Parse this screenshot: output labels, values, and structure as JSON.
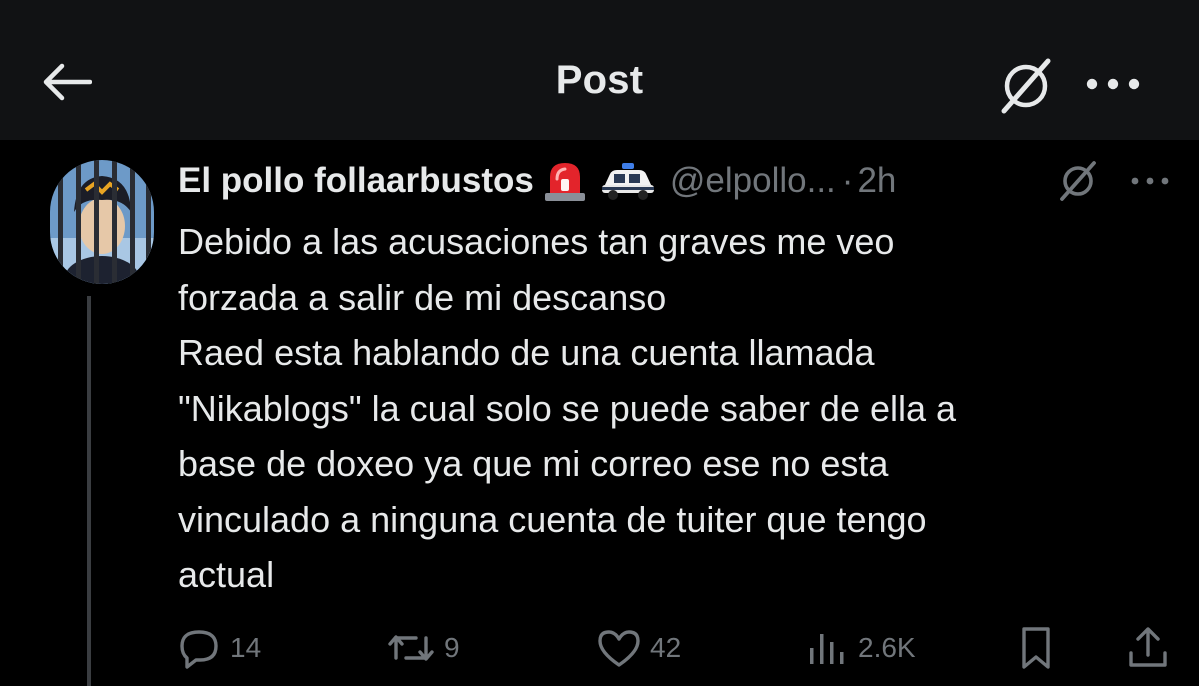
{
  "header": {
    "title": "Post",
    "back_icon": "arrow-left-icon",
    "grok_icon": "grok-slash-icon",
    "more_icon": "more-horizontal-icon"
  },
  "tweet": {
    "display_name": "El pollo follaarbustos",
    "name_emojis": [
      "rotating-light-emoji",
      "police-car-emoji"
    ],
    "handle": "@elpollo...",
    "separator": "·",
    "time": "2h",
    "body_lines": [
      "Debido a las acusaciones tan graves me veo",
      "forzada a salir de mi descanso",
      "Raed esta hablando de una cuenta llamada",
      "\"Nikablogs\" la cual solo se puede saber de ella a",
      "base de doxeo ya que mi correo ese no esta",
      "vinculado a ninguna cuenta de tuiter que tengo",
      "actual"
    ]
  },
  "actions": {
    "replies": "14",
    "reposts": "9",
    "likes": "42",
    "views": "2.6K"
  },
  "colors": {
    "background": "#000000",
    "header_bg": "#111214",
    "text_primary": "#e7e9ea",
    "text_secondary": "#71767b"
  }
}
